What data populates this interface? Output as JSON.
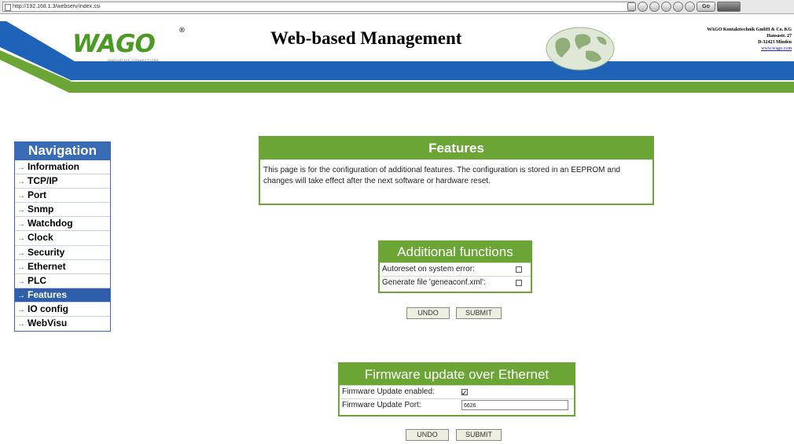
{
  "browser": {
    "url": "http://192.168.1.3/webserv/index.ssi",
    "go_label": "Go"
  },
  "header": {
    "logo_text": "WAGO",
    "logo_reg": "®",
    "logo_tagline": "INNOVATIVE CONNECTIONS",
    "title": "Web-based Management",
    "company_line1": "WAGO Kontakttechnik GmbH & Co. KG",
    "company_line2": "Hansastr. 27",
    "company_line3": "D-32423 Minden",
    "company_link": "www.wago.com",
    "colors": {
      "blue_band": "#1e63b8",
      "green_band": "#6aa535"
    }
  },
  "navigation": {
    "title": "Navigation",
    "items": [
      {
        "label": "Information"
      },
      {
        "label": "TCP/IP"
      },
      {
        "label": "Port"
      },
      {
        "label": "Snmp"
      },
      {
        "label": "Watchdog"
      },
      {
        "label": "Clock"
      },
      {
        "label": "Security"
      },
      {
        "label": "Ethernet"
      },
      {
        "label": "PLC"
      },
      {
        "label": "Features",
        "active": true
      },
      {
        "label": "IO config"
      },
      {
        "label": "WebVisu"
      }
    ]
  },
  "features": {
    "title": "Features",
    "description": "This page is for the configuration of additional features. The configuration is stored in an EEPROM and changes will take effect after the next software or hardware reset."
  },
  "additional_functions": {
    "title": "Additional functions",
    "rows": [
      {
        "label": "Autoreset on system error:",
        "checked": false
      },
      {
        "label": "Generate file 'geneaconf.xml':",
        "checked": false
      }
    ],
    "undo_label": "UNDO",
    "submit_label": "SUBMIT"
  },
  "firmware_update": {
    "title": "Firmware update over Ethernet",
    "enabled_label": "Firmware Update enabled:",
    "enabled_checked": true,
    "port_label": "Firmware Update Port:",
    "port_value": "6626",
    "undo_label": "UNDO",
    "submit_label": "SUBMIT"
  },
  "accent_colors": {
    "green": "#6aa535",
    "nav_blue": "#3a6bb5"
  }
}
